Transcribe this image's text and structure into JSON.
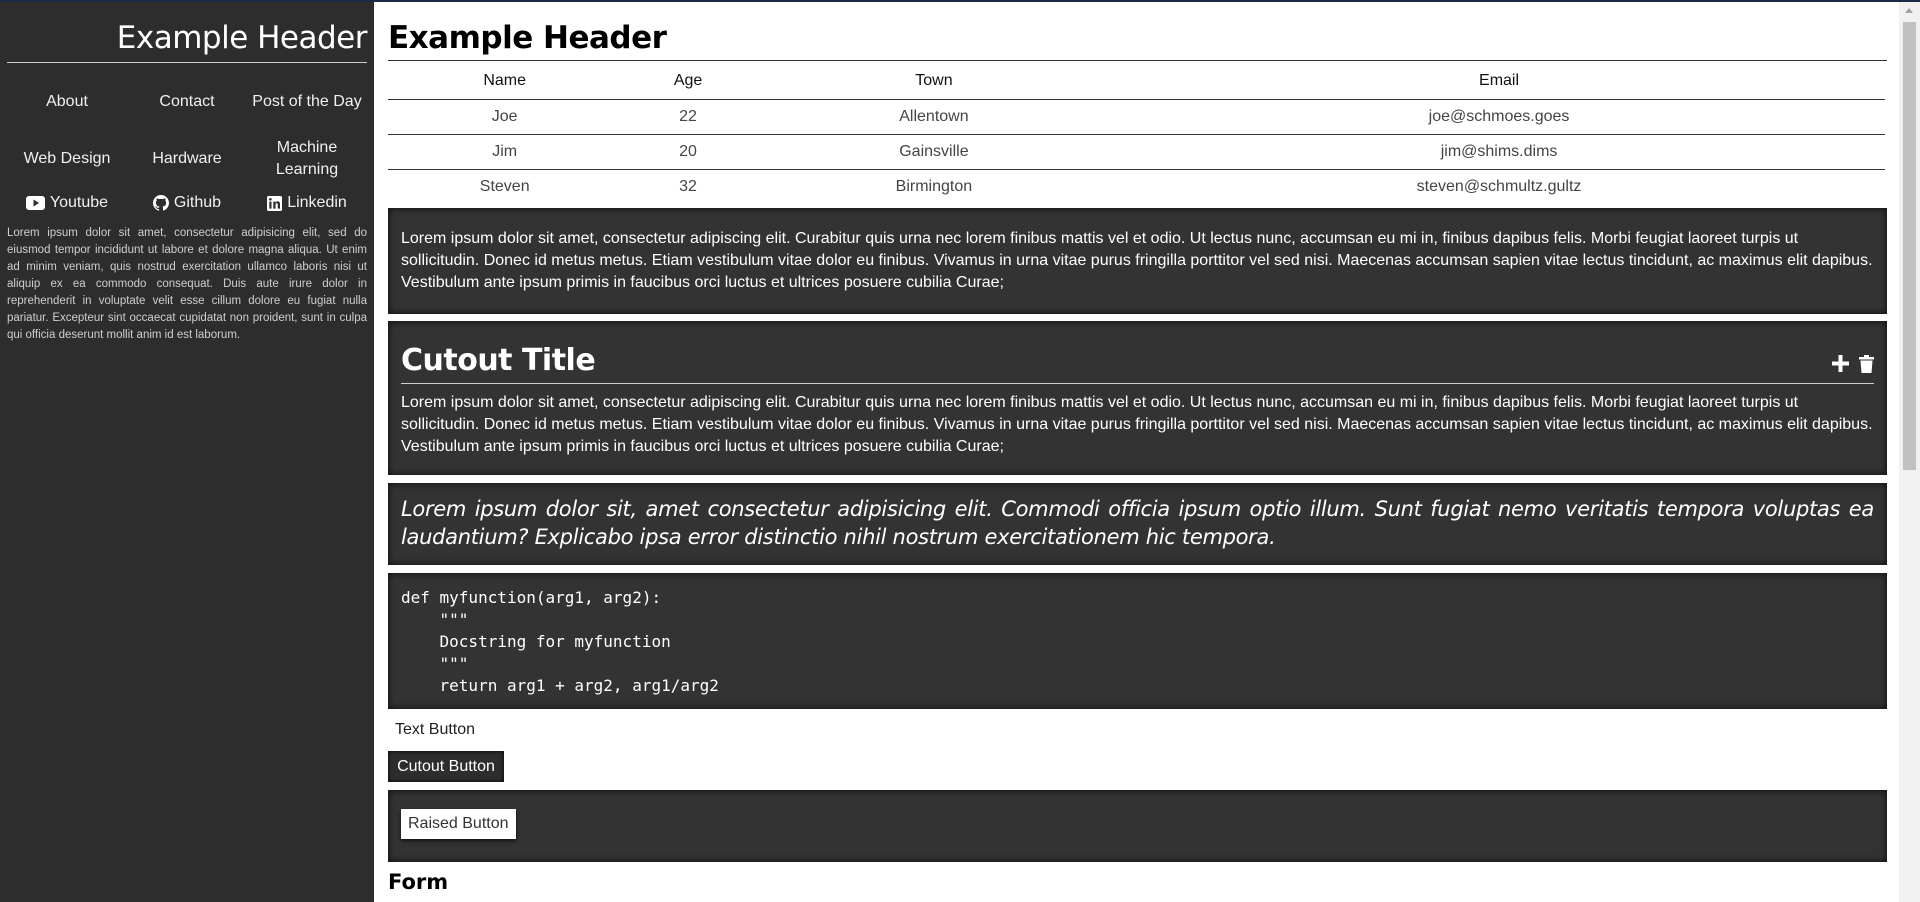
{
  "sidebar": {
    "brand": "Example Header",
    "nav": [
      "About",
      "Contact",
      "Post of the Day",
      "Web Design",
      "Hardware",
      "Machine Learning"
    ],
    "social": [
      {
        "label": "Youtube",
        "icon": "youtube-icon"
      },
      {
        "label": "Github",
        "icon": "github-icon"
      },
      {
        "label": "Linkedin",
        "icon": "linkedin-icon"
      }
    ],
    "paragraph": "Lorem ipsum dolor sit amet, consectetur adipisicing elit, sed do eiusmod tempor incididunt ut labore et dolore magna aliqua. Ut enim ad minim veniam, quis nostrud exercitation ullamco laboris nisi ut aliquip ex ea commodo consequat. Duis aute irure dolor in reprehenderit in voluptate velit esse cillum dolore eu fugiat nulla pariatur. Excepteur sint occaecat cupidatat non proident, sunt in culpa qui officia deserunt mollit anim id est laborum."
  },
  "main": {
    "title": "Example Header",
    "table": {
      "headers": [
        "Name",
        "Age",
        "Town",
        "Email"
      ],
      "rows": [
        [
          "Joe",
          "22",
          "Allentown",
          "joe@schmoes.goes"
        ],
        [
          "Jim",
          "20",
          "Gainsville",
          "jim@shims.dims"
        ],
        [
          "Steven",
          "32",
          "Birmington",
          "steven@schmultz.gultz"
        ]
      ]
    },
    "card_text": "Lorem ipsum dolor sit amet, consectetur adipiscing elit. Curabitur quis urna nec lorem finibus mattis vel et odio. Ut lectus nunc, accumsan eu mi in, finibus dapibus felis. Morbi feugiat laoreet turpis ut sollicitudin. Donec id metus metus. Etiam vestibulum vitae dolor eu finibus. Vivamus in urna vitae purus fringilla porttitor vel sed nisi. Maecenas accumsan sapien vitae lectus tincidunt, ac maximus elit dapibus. Vestibulum ante ipsum primis in faucibus orci luctus et ultrices posuere cubilia Curae;",
    "cutout": {
      "title": "Cutout Title",
      "body": "Lorem ipsum dolor sit amet, consectetur adipiscing elit. Curabitur quis urna nec lorem finibus mattis vel et odio. Ut lectus nunc, accumsan eu mi in, finibus dapibus felis. Morbi feugiat laoreet turpis ut sollicitudin. Donec id metus metus. Etiam vestibulum vitae dolor eu finibus. Vivamus in urna vitae purus fringilla porttitor vel sed nisi. Maecenas accumsan sapien vitae lectus tincidunt, ac maximus elit dapibus. Vestibulum ante ipsum primis in faucibus orci luctus et ultrices posuere cubilia Curae;"
    },
    "quote": "Lorem ipsum dolor sit, amet consectetur adipisicing elit. Commodi officia ipsum optio illum. Sunt fugiat nemo veritatis tempora voluptas ea laudantium? Explicabo ipsa error distinctio nihil nostrum exercitationem hic tempora.",
    "code": "def myfunction(arg1, arg2):\n    \"\"\"\n    Docstring for myfunction\n    \"\"\"\n    return arg1 + arg2, arg1/arg2",
    "text_button": "Text Button",
    "cutout_button": "Cutout Button",
    "raised_button": "Raised Button",
    "form_title": "Form"
  },
  "colors": {
    "sidebar_bg": "#2d2d2d",
    "card_bg": "#333333",
    "top_accent": "#1c2a4a"
  }
}
